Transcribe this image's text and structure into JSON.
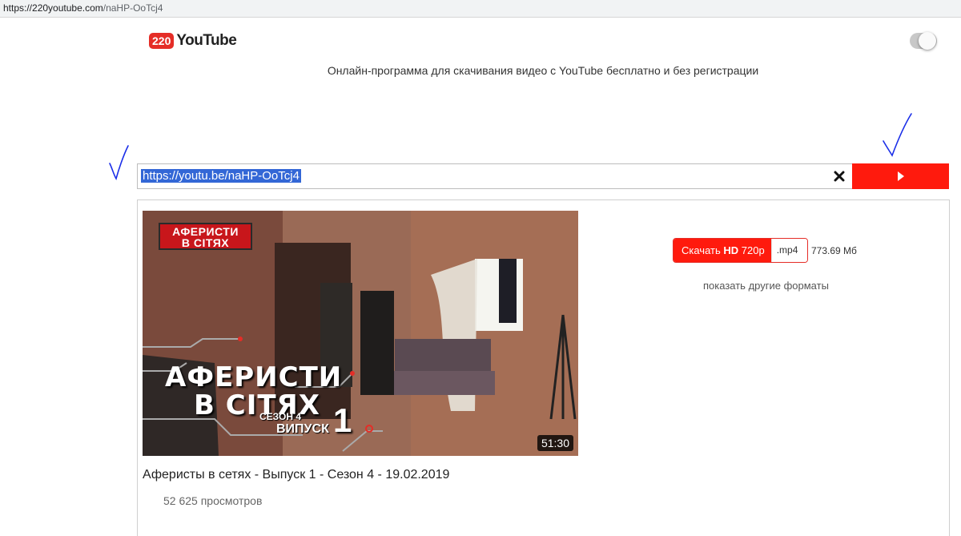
{
  "browser": {
    "url_host": "https://220youtube.com",
    "url_path": "/naHP-OoTcj4"
  },
  "header": {
    "logo_badge": "220",
    "logo_text": "YouTube",
    "tagline": "Онлайн-программа для скачивания видео с YouTube бесплатно и без регистрации"
  },
  "search": {
    "url_value": "https://youtu.be/naHP-OoTcj4",
    "clear_glyph": "✕",
    "go_icon": "play-triangle-icon"
  },
  "video": {
    "thumbnail_show_logo_l1": "АФЕРИСТИ",
    "thumbnail_show_logo_l2": "В СІТЯХ",
    "thumbnail_title_l1": "АФЕРИСТИ",
    "thumbnail_title_l2": "В СІТЯХ",
    "thumbnail_season": "СЕЗОН 4",
    "thumbnail_episode": "ВИПУСК",
    "thumbnail_episode_num": "1",
    "duration": "51:30",
    "title": "Аферисты в сетях - Выпуск 1 - Сезон 4 - 19.02.2019",
    "views": "52 625 просмотров"
  },
  "download": {
    "label_prefix": "Скачать",
    "label_hd": "HD",
    "label_quality": "720p",
    "format": ".mp4",
    "size": "773.69 Мб",
    "other_formats": "показать другие форматы"
  },
  "colors": {
    "accent": "#ff1a0d",
    "selection": "#3367d6",
    "annotation": "#1a2ee8"
  }
}
